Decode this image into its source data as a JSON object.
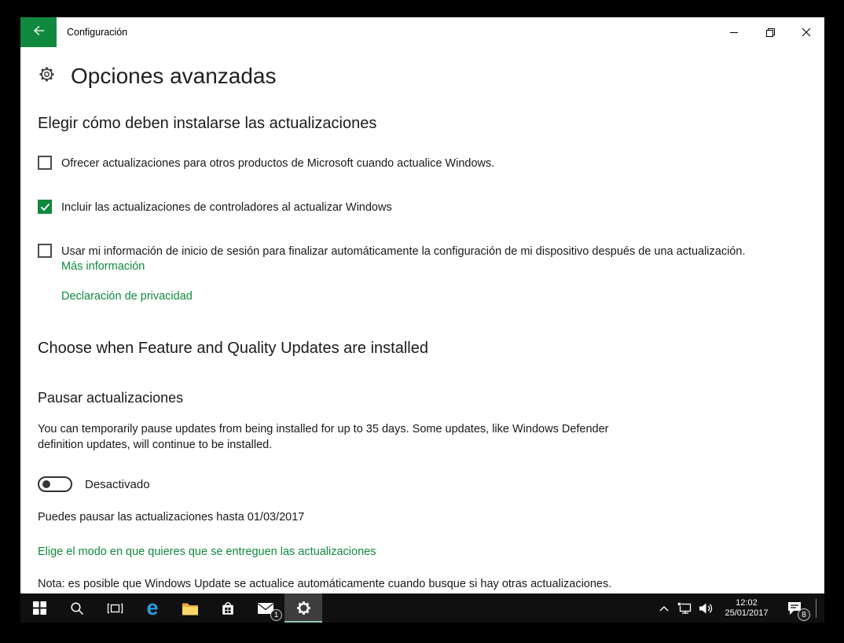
{
  "colors": {
    "accent_green": "#10893E",
    "taskbar_active_underline": "#8fc9ae",
    "taskbar_background": "#101010"
  },
  "titlebar": {
    "app_title": "Configuración",
    "icons": [
      "back-arrow",
      "minimize",
      "restore",
      "close"
    ]
  },
  "page": {
    "title": "Opciones avanzadas",
    "install_section": {
      "heading": "Elegir cómo deben instalarse las actualizaciones",
      "checkboxes": [
        {
          "checked": false,
          "label": "Ofrecer actualizaciones para otros productos de Microsoft cuando actualice Windows."
        },
        {
          "checked": true,
          "label": "Incluir las actualizaciones de controladores al actualizar Windows"
        },
        {
          "checked": false,
          "label": "Usar mi información de inicio de sesión para finalizar automáticamente la configuración de mi dispositivo después de una actualización."
        }
      ],
      "more_info_link": "Más información",
      "privacy_link": "Declaración de privacidad"
    },
    "updates_section": {
      "heading": "Choose when Feature and Quality Updates are installed",
      "pause_heading": "Pausar actualizaciones",
      "pause_description": "You can temporarily pause updates from being installed for up to 35 days. Some updates, like Windows Defender definition updates, will continue to be installed.",
      "toggle_state_label": "Desactivado",
      "toggle_on": false,
      "pause_until_text": "Puedes pausar las actualizaciones hasta 01/03/2017",
      "delivery_link": "Elige el modo en que quieres que se entreguen las actualizaciones",
      "note": "Nota: es posible que Windows Update se actualice automáticamente cuando busque si hay otras actualizaciones."
    }
  },
  "taskbar": {
    "app_icons": [
      "start",
      "search",
      "task-view",
      "edge",
      "file-explorer",
      "store",
      "mail",
      "settings"
    ],
    "active_app": "settings",
    "edge_glyph": "e",
    "mail_badge": "1",
    "tray": {
      "hidden_icons_chevron": "^",
      "time": "12:02",
      "date": "25/01/2017",
      "notification_badge": "8"
    }
  }
}
